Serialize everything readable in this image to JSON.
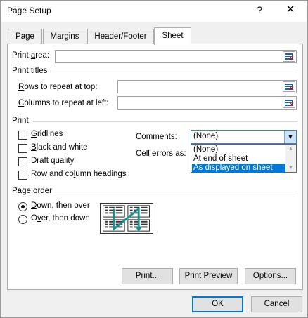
{
  "window": {
    "title": "Page Setup",
    "help_glyph": "?",
    "close_glyph": "✕"
  },
  "tabs": [
    {
      "label": "Page"
    },
    {
      "label": "Margins"
    },
    {
      "label": "Header/Footer"
    },
    {
      "label": "Sheet"
    }
  ],
  "print_area": {
    "label_pre": "Print ",
    "label_ul": "a",
    "label_post": "rea:",
    "value": ""
  },
  "print_titles": {
    "group_label": "Print titles",
    "rows": {
      "label_ul": "R",
      "label_post": "ows to repeat at top:",
      "value": ""
    },
    "columns": {
      "label_ul": "C",
      "label_post": "olumns to repeat at left:",
      "value": ""
    }
  },
  "print": {
    "group_label": "Print",
    "gridlines": {
      "label_ul": "G",
      "label_post": "ridlines",
      "checked": false
    },
    "black_white": {
      "label_ul": "B",
      "label_post": "lack and white",
      "checked": false
    },
    "draft": {
      "label_pre": "Draft ",
      "label_ul": "q",
      "label_post": "uality",
      "checked": false
    },
    "row_col_headings": {
      "label_pre": "Row and co",
      "label_ul": "l",
      "label_post": "umn headings",
      "checked": false
    },
    "comments": {
      "label_pre": "Co",
      "label_ul": "m",
      "label_post": "ments:",
      "selected": "(None)",
      "options": [
        "(None)",
        "At end of sheet",
        "As displayed on sheet"
      ],
      "highlighted_index": 2
    },
    "cell_errors": {
      "label_pre": "Cell ",
      "label_ul": "e",
      "label_post": "rrors as:"
    }
  },
  "page_order": {
    "group_label": "Page order",
    "down_then_over": {
      "label_ul": "D",
      "label_post": "own, then over",
      "selected": true
    },
    "over_then_down": {
      "label_pre": "O",
      "label_ul": "v",
      "label_post": "er, then down",
      "selected": false
    }
  },
  "buttons": {
    "print": {
      "label_pre": "",
      "label_ul": "P",
      "label_post": "rint..."
    },
    "print_preview": {
      "label_pre": "Print Pre",
      "label_ul": "v",
      "label_post": "iew"
    },
    "options": {
      "label_ul": "O",
      "label_post": "ptions..."
    },
    "ok": "OK",
    "cancel": "Cancel"
  },
  "colors": {
    "accent": "#0078d7",
    "panel_bg": "#ffffff",
    "dialog_bg": "#f0f0f0"
  }
}
